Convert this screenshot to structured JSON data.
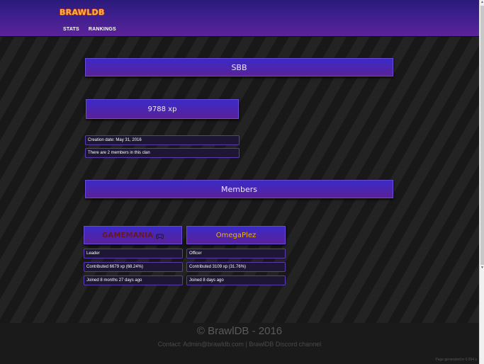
{
  "header": {
    "logo": "BRAWLDB",
    "nav": [
      {
        "label": "STATS"
      },
      {
        "label": "RANKINGS"
      }
    ]
  },
  "clan": {
    "name": "SBB",
    "xp": "9788 xp",
    "creation": "Creation date: May 31, 2016",
    "member_count": "There are 2 members in this clan"
  },
  "members_heading": "Members",
  "members": [
    {
      "name": "GAMEMANIA",
      "role": "Leader",
      "contributed": "Contributed 6679 xp (68.24%)",
      "joined": "Joined 8 months 27 days ago"
    },
    {
      "name": "OmegaPlez",
      "role": "Officer",
      "contributed": "Contributed 3109 xp (31.76%)",
      "joined": "Joined 8 days ago"
    }
  ],
  "footer": {
    "title": "© BrawlDB - 2016",
    "contact": "Contact: Admin@brawldb.com | BrawlDB Discord channel",
    "page_generated": "Page generated in 0.094 s"
  },
  "colors": {
    "header_top": "#2a1a7a",
    "header_bottom": "#5b2399",
    "panel": "#4a26b0",
    "logo": "#ffb347",
    "member_gold": "#f0b400",
    "member_red": "#6b1525"
  }
}
